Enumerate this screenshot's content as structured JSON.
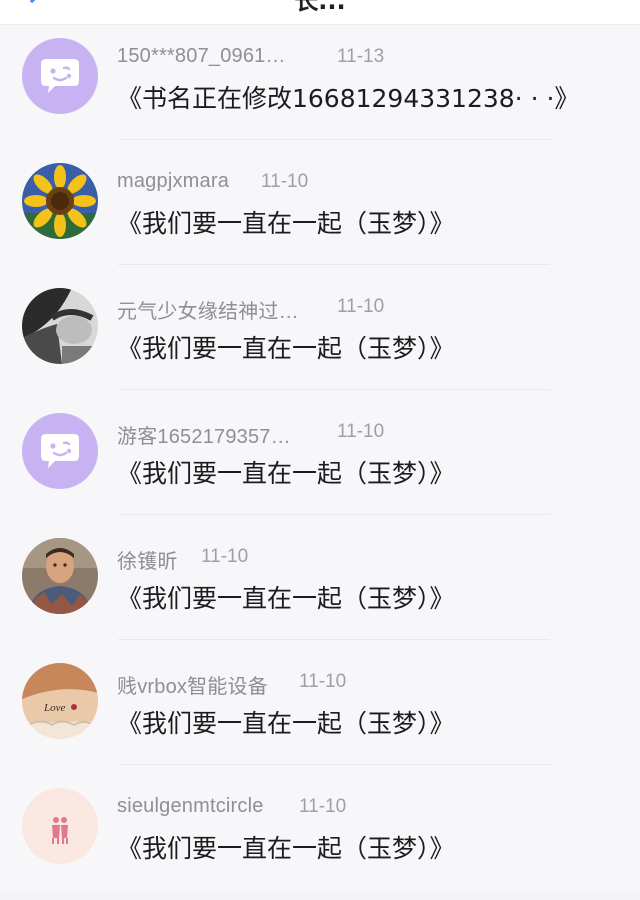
{
  "header": {
    "title": "长..."
  },
  "comments": [
    {
      "username": "150***807_0961…",
      "time": "11-13",
      "content": "《书名正在修改16681294331238· · ·》",
      "avatar": "default-chat-avatar-icon"
    },
    {
      "username": "magpjxmara",
      "time": "11-10",
      "content": "《我们要一直在一起（玉梦）》",
      "avatar": "sunflower-avatar"
    },
    {
      "username": "元气少女缘结神过…",
      "time": "11-10",
      "content": "《我们要一直在一起（玉梦）》",
      "avatar": "portrait-grey-avatar"
    },
    {
      "username": "游客1652179357…",
      "time": "11-10",
      "content": "《我们要一直在一起（玉梦）》",
      "avatar": "default-chat-avatar-icon"
    },
    {
      "username": "徐镬昕",
      "time": "11-10",
      "content": "《我们要一直在一起（玉梦）》",
      "avatar": "man-photo-avatar"
    },
    {
      "username": "贱vrbox智能设备",
      "time": "11-10",
      "content": "《我们要一直在一起（玉梦）》",
      "avatar": "tattoo-photo-avatar"
    },
    {
      "username": "sieulgenmtcircle",
      "time": "11-10",
      "content": "《我们要一直在一起（玉梦）》",
      "avatar": "pink-couple-avatar"
    }
  ],
  "colors": {
    "default_avatar_bg": "#c8b3f2",
    "text_primary": "#1c1c1e",
    "text_secondary": "#8f8f94",
    "accent": "#3f8cff"
  }
}
